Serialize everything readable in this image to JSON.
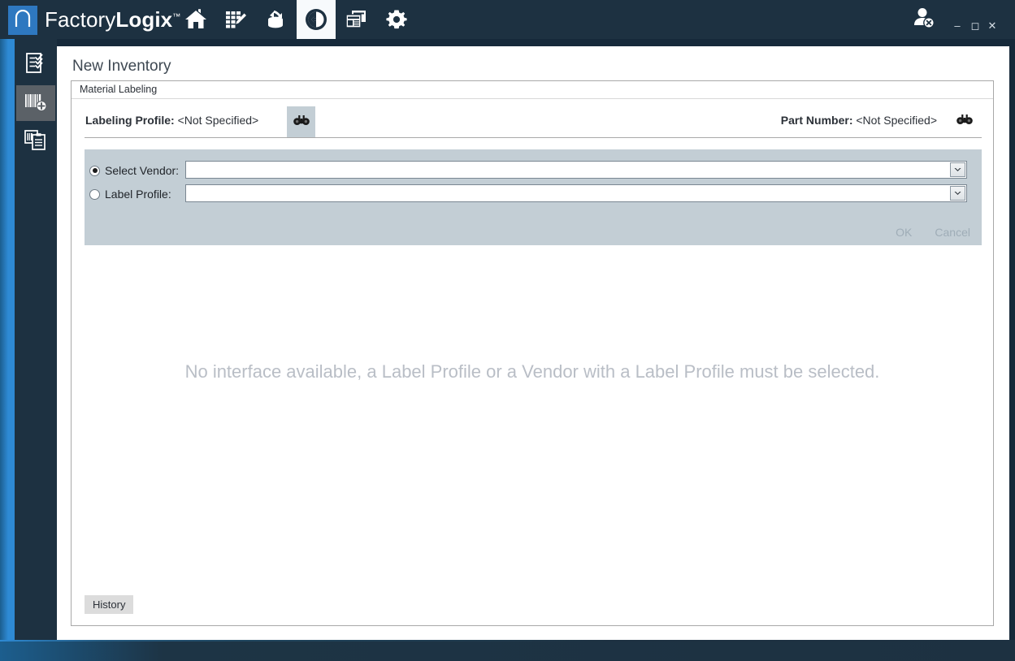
{
  "app": {
    "brand_prefix": "Factory",
    "brand_suffix": "Logix",
    "brand_tm": "™",
    "logo_icon": "n-logo-icon"
  },
  "topbar": {
    "nav_items": [
      {
        "name": "home-nav-button",
        "icon": "home-icon",
        "selected": false
      },
      {
        "name": "planning-nav-button",
        "icon": "grid-pencil-icon",
        "selected": false
      },
      {
        "name": "process-nav-button",
        "icon": "stack-hand-icon",
        "selected": false
      },
      {
        "name": "materials-nav-button",
        "icon": "arrows-circle-icon",
        "selected": true
      },
      {
        "name": "reports-nav-button",
        "icon": "windows-icon",
        "selected": false
      },
      {
        "name": "settings-nav-button",
        "icon": "gear-icon",
        "selected": false
      }
    ],
    "user_icon": "user-logout-icon",
    "window_controls": {
      "minimize": "–",
      "maximize": "◻",
      "close": "✕"
    }
  },
  "sidebar": {
    "items": [
      {
        "name": "sidebar-item-checklist",
        "icon": "checklist-icon",
        "selected": false
      },
      {
        "name": "sidebar-item-new-inventory",
        "icon": "barcode-plus-icon",
        "selected": true
      },
      {
        "name": "sidebar-item-duplicate",
        "icon": "documents-copy-icon",
        "selected": false
      }
    ]
  },
  "page": {
    "title": "New Inventory"
  },
  "panel": {
    "tab_label": "Material Labeling",
    "labeling_profile": {
      "label": "Labeling Profile:",
      "value": "<Not Specified>",
      "find_icon": "binoculars-icon"
    },
    "part_number": {
      "label": "Part Number:",
      "value": "<Not Specified>",
      "find_icon": "binoculars-icon"
    },
    "selector": {
      "vendor": {
        "label": "Select Vendor:",
        "selected": true,
        "value": "",
        "placeholder": ""
      },
      "profile": {
        "label": "Label Profile:",
        "selected": false,
        "value": "",
        "placeholder": ""
      },
      "ok_label": "OK",
      "cancel_label": "Cancel",
      "dropdown_icon": "chevron-down-icon"
    },
    "empty_message": "No interface available, a Label Profile or a Vendor with a Label Profile must be selected.",
    "history_label": "History"
  },
  "colors": {
    "chrome_dark": "#1d3141",
    "accent_blue": "#2e8ad4",
    "brand_blue": "#2e78c0",
    "panel_grey": "#c3ced5",
    "muted_text": "#b9bec6"
  }
}
